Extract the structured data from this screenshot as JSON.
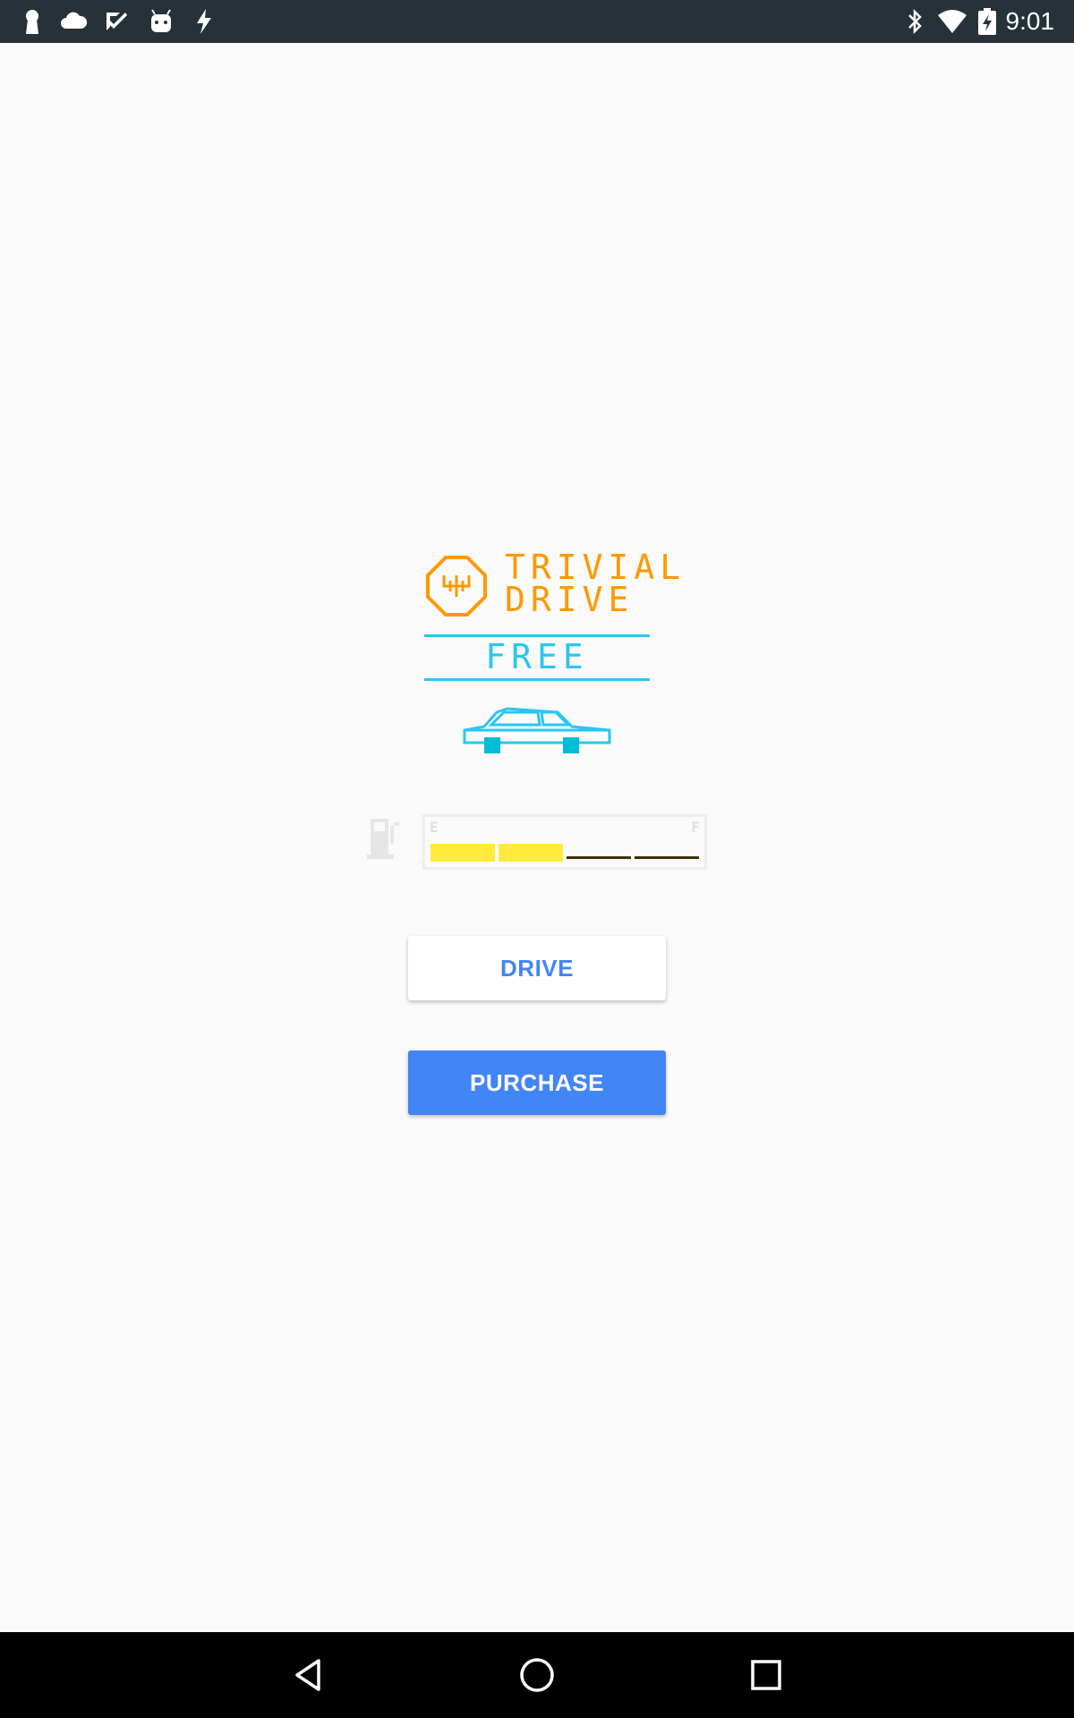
{
  "status_bar": {
    "time": "9:01",
    "left_icons": [
      "keyhole-icon",
      "cloud-icon",
      "checkbox-icon",
      "android-icon",
      "flash-icon"
    ],
    "right_icons": [
      "bluetooth-icon",
      "wifi-icon",
      "battery-charging-icon"
    ]
  },
  "app": {
    "title_line1": "TRIVIAL",
    "title_line2": "DRIVE",
    "edition": "FREE",
    "gauge": {
      "empty_label": "E",
      "full_label": "F",
      "filled_segments": 2,
      "total_segments": 4
    },
    "drive_label": "DRIVE",
    "purchase_label": "PURCHASE"
  },
  "colors": {
    "accent_orange": "#ff9800",
    "accent_cyan": "#29c6f2",
    "fuel_yellow": "#ffeb3b",
    "button_blue": "#4285f4",
    "background": "#fafafa"
  },
  "nav_bar": {
    "buttons": [
      "back-icon",
      "home-icon",
      "recents-icon"
    ]
  }
}
